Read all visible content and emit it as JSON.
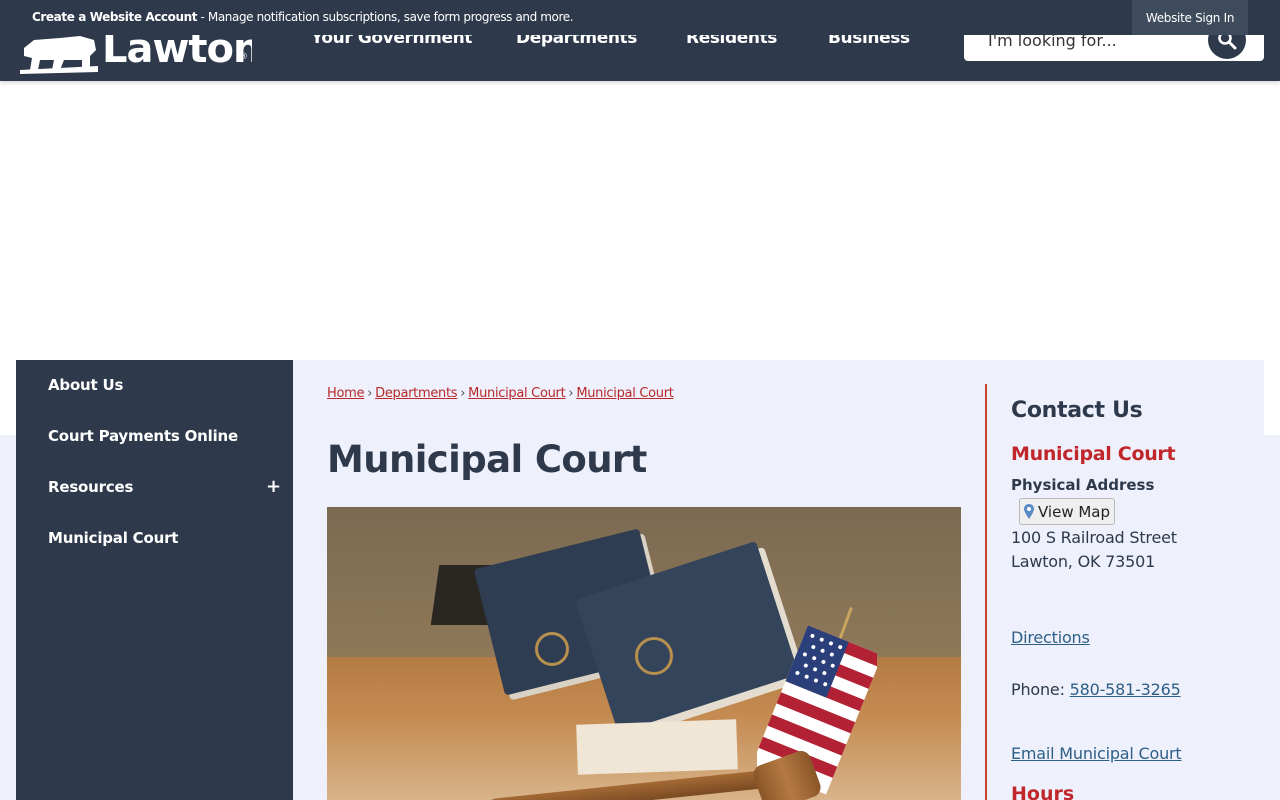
{
  "topbar": {
    "promo_bold": "Create a Website Account",
    "promo_text": " - Manage notification subscriptions, save form progress and more.",
    "signin_label": "Website Sign In"
  },
  "header": {
    "logo_text": "Lawton",
    "logo_mark": "®",
    "nav": [
      "Your Government",
      "Departments",
      "Residents",
      "Business"
    ],
    "search_placeholder": "I'm looking for...",
    "colors": {
      "header_bg": "#2e3a4b",
      "accent_red": "#c0262a"
    }
  },
  "sidebar": {
    "items": [
      {
        "label": "About Us"
      },
      {
        "label": "Court Payments Online"
      },
      {
        "label": "Resources",
        "expand_icon": "+"
      },
      {
        "label": "Municipal Court"
      }
    ]
  },
  "main": {
    "breadcrumb": [
      "Home",
      "Departments",
      "Municipal Court",
      "Municipal Court"
    ],
    "breadcrumb_separator": "›",
    "title": "Municipal Court",
    "photo_alt": "courtroom-gavel-flag-books"
  },
  "contact": {
    "heading": "Contact Us",
    "org": "Municipal Court",
    "address_label": "Physical Address",
    "map_button": "View Map",
    "street": "100 S Railroad Street",
    "city": "Lawton, OK 73501",
    "directions": "Directions",
    "phone_label": "Phone: ",
    "phone": "580-581-3265",
    "email": "Email Municipal Court",
    "hours_label": "Hours"
  }
}
